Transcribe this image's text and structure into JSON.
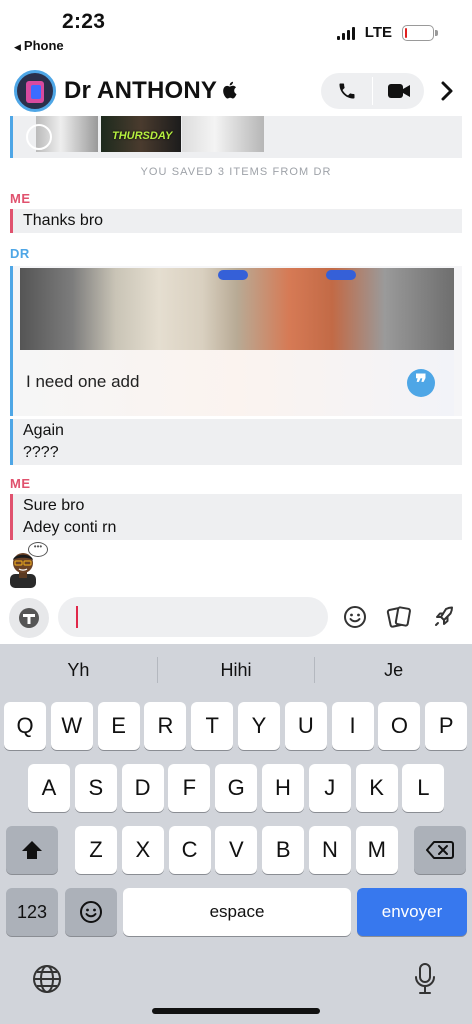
{
  "status_bar": {
    "time": "2:23",
    "back_app": "Phone",
    "network": "LTE",
    "battery_level": 0.08,
    "battery_color": "#e02020"
  },
  "header": {
    "contact_name": "Dr ANTHONY",
    "badge_icon": "apple-icon",
    "call_icon": "phone-icon",
    "video_icon": "video-camera-icon",
    "more_icon": "chevron-right-icon"
  },
  "chat": {
    "media_sticker_text": "THURSDAY",
    "saved_note": "YOU SAVED 3 ITEMS FROM DR",
    "messages": [
      {
        "sender": "ME",
        "lines": [
          "Thanks bro"
        ]
      },
      {
        "sender": "DR",
        "caption": "I need one add",
        "lines": [
          "Again",
          "????"
        ]
      },
      {
        "sender": "ME",
        "lines": [
          "Sure bro",
          "Adey conti rn"
        ]
      }
    ],
    "typing_indicator": "•••"
  },
  "composer": {
    "value": "",
    "placeholder": "",
    "icons": [
      "bitmoji-avatar-icon",
      "smiley-icon",
      "cards-icon",
      "rocket-icon"
    ]
  },
  "keyboard": {
    "suggestions": [
      "Yh",
      "Hihi",
      "Je"
    ],
    "row1": [
      "Q",
      "W",
      "E",
      "R",
      "T",
      "Y",
      "U",
      "I",
      "O",
      "P"
    ],
    "row2": [
      "A",
      "S",
      "D",
      "F",
      "G",
      "H",
      "J",
      "K",
      "L"
    ],
    "row3": [
      "Z",
      "X",
      "C",
      "V",
      "B",
      "N",
      "M"
    ],
    "numbers_key": "123",
    "space_key": "espace",
    "return_key": "envoyer",
    "accent_color": "#3778ee"
  },
  "colors": {
    "me": "#e0526e",
    "dr": "#4ea6e6"
  }
}
